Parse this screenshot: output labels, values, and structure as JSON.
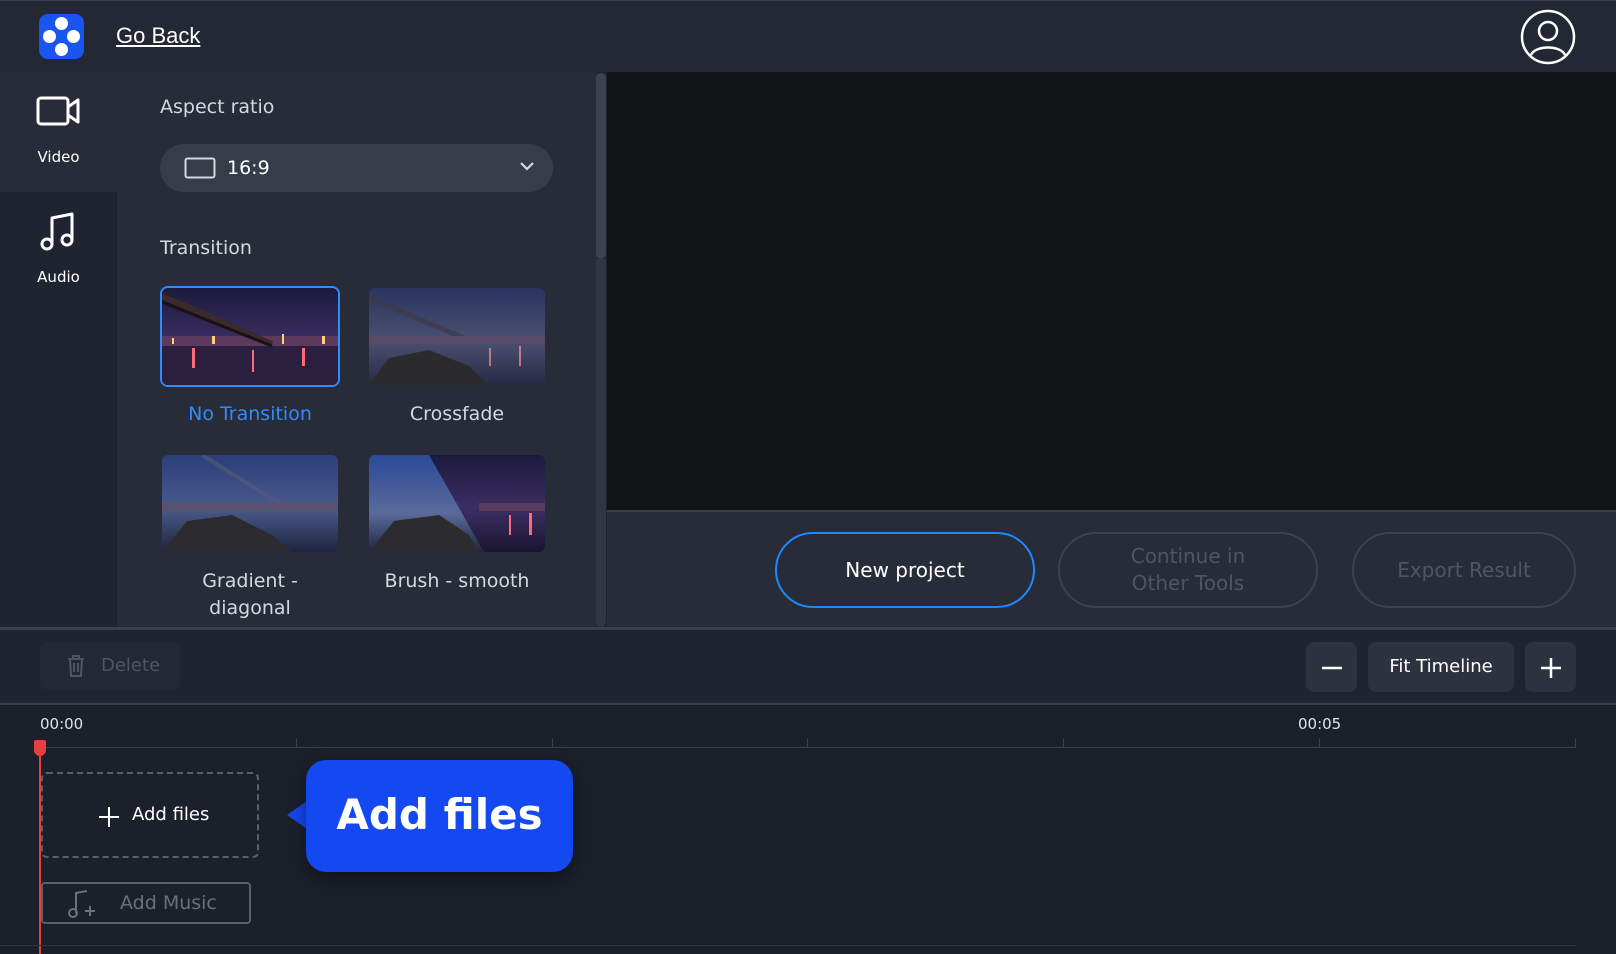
{
  "header": {
    "go_back": "Go Back"
  },
  "rail": {
    "items": [
      {
        "label": "Video",
        "icon": "video-camera-icon",
        "active": true
      },
      {
        "label": "Audio",
        "icon": "music-note-icon",
        "active": false
      }
    ]
  },
  "panel": {
    "aspect_ratio_title": "Aspect ratio",
    "aspect_ratio_value": "16:9",
    "transition_title": "Transition",
    "transitions": [
      {
        "label": "No Transition",
        "selected": true
      },
      {
        "label": "Crossfade",
        "selected": false
      },
      {
        "label": "Gradient - diagonal",
        "selected": false
      },
      {
        "label": "Brush - smooth",
        "selected": false
      }
    ]
  },
  "actions": {
    "new_project": "New project",
    "continue_other": "Continue in Other Tools",
    "export_result": "Export Result"
  },
  "timeline_toolbar": {
    "delete": "Delete",
    "fit_timeline": "Fit Timeline"
  },
  "timeline": {
    "time_start": "00:00",
    "time_mark": "00:05",
    "add_files": "Add files",
    "add_music": "Add Music",
    "tooltip": "Add files"
  },
  "colors": {
    "accent": "#1e88ff",
    "selected_text": "#2f8cff",
    "tooltip_bg": "#1448f0",
    "playhead": "#e84040",
    "logo_bg": "#1a55f0"
  }
}
